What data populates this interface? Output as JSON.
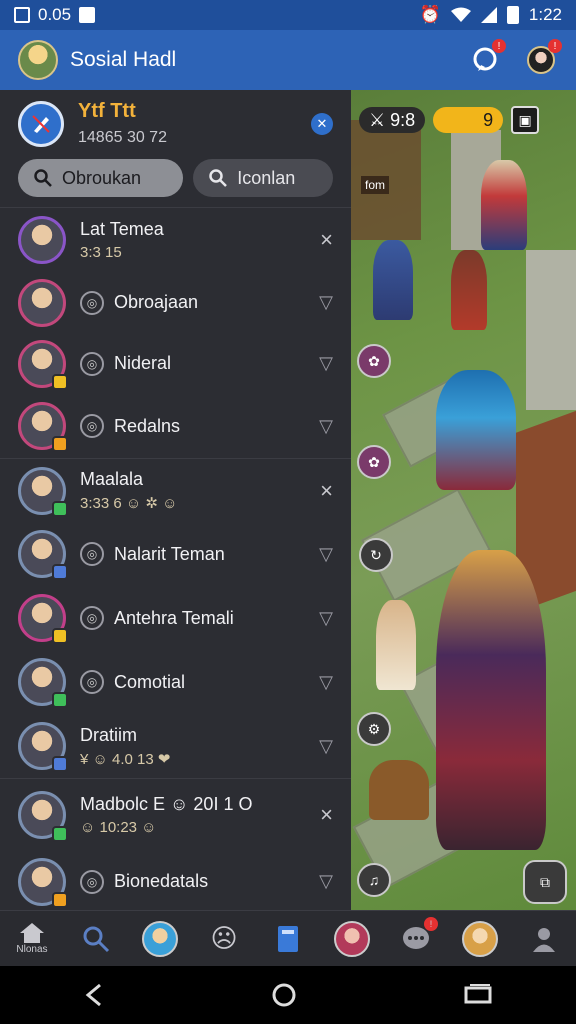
{
  "status_bar": {
    "time_left": "0.05",
    "time_right": "1:22"
  },
  "header": {
    "title": "Sosial Hadl"
  },
  "drawer": {
    "profile": {
      "name": "Ytf Ttt",
      "sub": "14865 30 72"
    },
    "search_chips": [
      {
        "label": "Obroukan"
      },
      {
        "label": "Iconlan"
      }
    ],
    "items": [
      {
        "name": "Lat Temea",
        "sub": "3:3 15",
        "action": "×",
        "ring": "#8a55c8",
        "badge": ""
      },
      {
        "name": "Obroajaan",
        "action": "▽",
        "ring": "#c2487c",
        "badge": ""
      },
      {
        "name": "Nideral",
        "action": "▽",
        "ring": "#c2487c",
        "badge": "#f0c024"
      },
      {
        "name": "Redalns",
        "action": "▽",
        "ring": "#c2487c",
        "badge": "#f0a020"
      },
      {
        "name": "Maalala",
        "sub": "3:33 6 ☺ ✲ ☺",
        "action": "×",
        "ring": "#7a8fb0",
        "badge": "#3fbf5a"
      },
      {
        "name": "Nalarit Teman",
        "action": "▽",
        "ring": "#7a8fb0",
        "badge": "#4f7bd8"
      },
      {
        "name": "Antehra Temali",
        "action": "▽",
        "ring": "#c23f8a",
        "badge": "#f0c024"
      },
      {
        "name": "Comotial",
        "action": "▽",
        "ring": "#7a8fb0",
        "badge": "#3fbf5a"
      },
      {
        "name": "Dratiim",
        "sub": "¥ ☺ 4.0 13 ❤",
        "action": "▽",
        "ring": "#7a8fb0",
        "badge": "#4f7bd8"
      },
      {
        "name": "Madbolc E ☺ 20I 1 O",
        "sub": "☺ 10:23 ☺",
        "action": "×",
        "ring": "#7a8fb0",
        "badge": "#3fbf5a"
      },
      {
        "name": "Bionedatals",
        "action": "▽",
        "ring": "#7a8fb0",
        "badge": "#f0a020"
      }
    ]
  },
  "game_hud": {
    "lives": "9:8",
    "gold": "9",
    "tag": "fom"
  },
  "bottom_nav": {
    "home_label": "Nlonas"
  },
  "colors": {
    "header_blue": "#2d63b6",
    "status_blue": "#1f4f9b",
    "drawer_bg": "#2c2d33",
    "accent_gold": "#f3b23b",
    "alert_red": "#e53131"
  }
}
